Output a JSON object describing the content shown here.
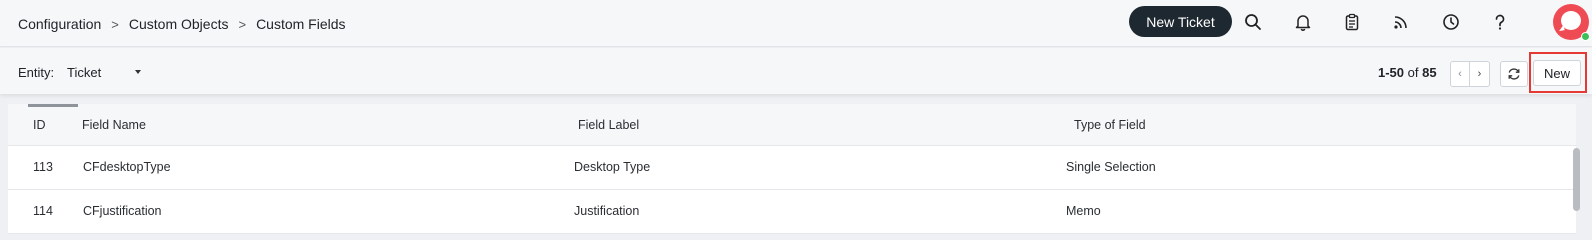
{
  "breadcrumb": {
    "items": [
      "Configuration",
      "Custom Objects",
      "Custom Fields"
    ],
    "separator": ">"
  },
  "header": {
    "new_ticket_label": "New Ticket",
    "icons": [
      "search-icon",
      "bell-icon",
      "clipboard-icon",
      "rss-icon",
      "clock-icon",
      "help-icon"
    ],
    "avatar_online": true
  },
  "toolbar": {
    "entity_label": "Entity:",
    "entity_value": "Ticket",
    "pager_range": "1-50",
    "pager_of": "of",
    "pager_total": "85",
    "prev_glyph": "‹",
    "next_glyph": "›",
    "new_label": "New"
  },
  "table": {
    "columns": [
      "ID",
      "Field Name",
      "Field Label",
      "Type of Field"
    ],
    "rows": [
      {
        "id": "113",
        "field_name": "CFdesktopType",
        "field_label": "Desktop Type",
        "type": "Single Selection"
      },
      {
        "id": "114",
        "field_name": "CFjustification",
        "field_label": "Justification",
        "type": "Memo"
      }
    ]
  },
  "colors": {
    "primary_dark": "#1e2830",
    "avatar": "#ef4b55",
    "online": "#3fbf5a",
    "highlight": "#e53935"
  }
}
